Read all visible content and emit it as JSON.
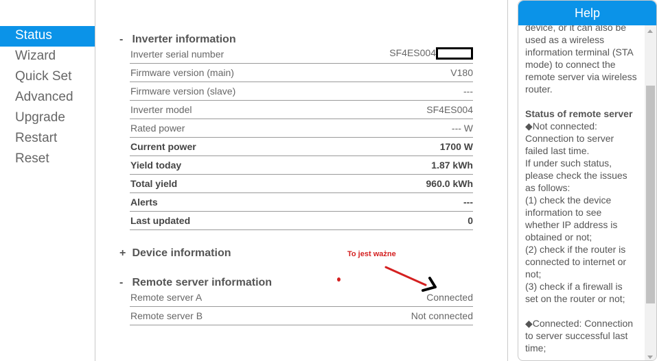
{
  "sidebar": {
    "items": [
      {
        "label": "Status"
      },
      {
        "label": "Wizard"
      },
      {
        "label": "Quick Set"
      },
      {
        "label": "Advanced"
      },
      {
        "label": "Upgrade"
      },
      {
        "label": "Restart"
      },
      {
        "label": "Reset"
      }
    ],
    "active": "Status"
  },
  "inverter": {
    "toggle": "-",
    "title": "Inverter information",
    "rows": [
      {
        "label": "Inverter serial number",
        "value": "SF4ES004"
      },
      {
        "label": "Firmware version (main)",
        "value": "V180"
      },
      {
        "label": "Firmware version (slave)",
        "value": "---"
      },
      {
        "label": "Inverter model",
        "value": "SF4ES004"
      },
      {
        "label": "Rated power",
        "value": "--- W"
      },
      {
        "label": "Current power",
        "value": "1700 W"
      },
      {
        "label": "Yield today",
        "value": "1.87 kWh"
      },
      {
        "label": "Total yield",
        "value": "960.0 kWh"
      },
      {
        "label": "Alerts",
        "value": "---"
      },
      {
        "label": "Last updated",
        "value": "0"
      }
    ]
  },
  "device": {
    "toggle": "+",
    "title": "Device information"
  },
  "remote": {
    "toggle": "-",
    "title": "Remote server information",
    "rows": [
      {
        "label": "Remote server A",
        "value": "Connected"
      },
      {
        "label": "Remote server B",
        "value": "Not connected"
      }
    ]
  },
  "annotation": {
    "text": "To jest ważne"
  },
  "help": {
    "title": "Help",
    "lines": [
      "device, or it can also be",
      "used as a wireless",
      "information terminal (STA",
      "mode) to connect the",
      "remote server via wireless",
      "router.",
      "",
      "Status of remote server",
      "◆Not connected:",
      "Connection to server",
      "failed last time.",
      "If under such status,",
      "please check the issues",
      "as follows:",
      "(1) check the device",
      "information to see",
      "whether IP address is",
      "obtained or not;",
      "(2) check if the router is",
      "connected to internet or",
      "not;",
      "(3) check if a firewall is",
      "set on the router or not;",
      "",
      "◆Connected: Connection",
      "to server successful last",
      "time;"
    ]
  },
  "colors": {
    "accent": "#0b93e8",
    "annotation": "#d42020"
  }
}
